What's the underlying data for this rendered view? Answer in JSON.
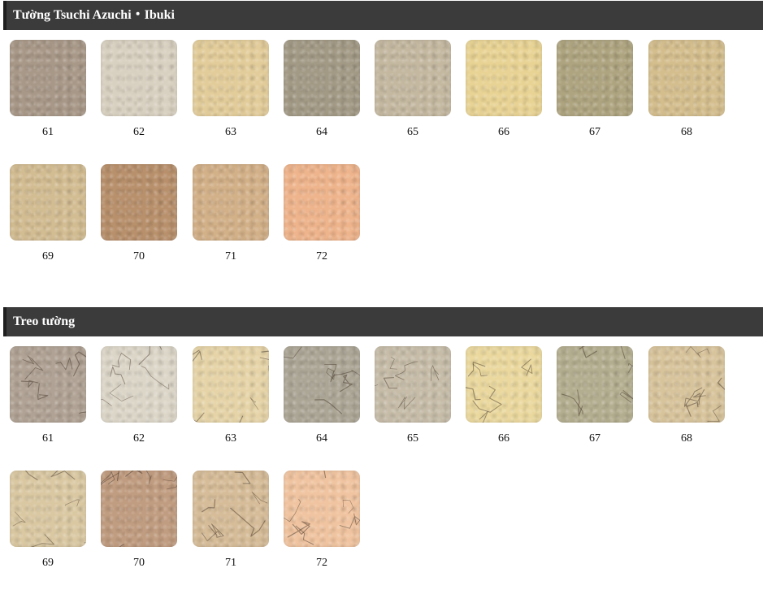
{
  "sections": [
    {
      "title": "Tường Tsuchi Azuchi・Ibuki",
      "style": "smooth",
      "swatches": [
        {
          "label": "61",
          "color": "#a89888"
        },
        {
          "label": "62",
          "color": "#d8d0c0"
        },
        {
          "label": "63",
          "color": "#e2cc9a"
        },
        {
          "label": "64",
          "color": "#a39a86"
        },
        {
          "label": "65",
          "color": "#c4b8a0"
        },
        {
          "label": "66",
          "color": "#e8d394"
        },
        {
          "label": "67",
          "color": "#aea480"
        },
        {
          "label": "68",
          "color": "#d4be8e"
        },
        {
          "label": "69",
          "color": "#d2bc92"
        },
        {
          "label": "70",
          "color": "#b8906c"
        },
        {
          "label": "71",
          "color": "#d2b088"
        },
        {
          "label": "72",
          "color": "#eeb48c"
        }
      ]
    },
    {
      "title": "Treo tường",
      "style": "cracked",
      "swatches": [
        {
          "label": "61",
          "color": "#b0a294"
        },
        {
          "label": "62",
          "color": "#dcd6c8"
        },
        {
          "label": "63",
          "color": "#e6d4a8"
        },
        {
          "label": "64",
          "color": "#aca696"
        },
        {
          "label": "65",
          "color": "#c6bca8"
        },
        {
          "label": "66",
          "color": "#ead89e"
        },
        {
          "label": "67",
          "color": "#b4ae90"
        },
        {
          "label": "68",
          "color": "#d8c49c"
        },
        {
          "label": "69",
          "color": "#dac8a2"
        },
        {
          "label": "70",
          "color": "#c09c80"
        },
        {
          "label": "71",
          "color": "#d6bc98"
        },
        {
          "label": "72",
          "color": "#f0c4a0"
        }
      ]
    }
  ]
}
